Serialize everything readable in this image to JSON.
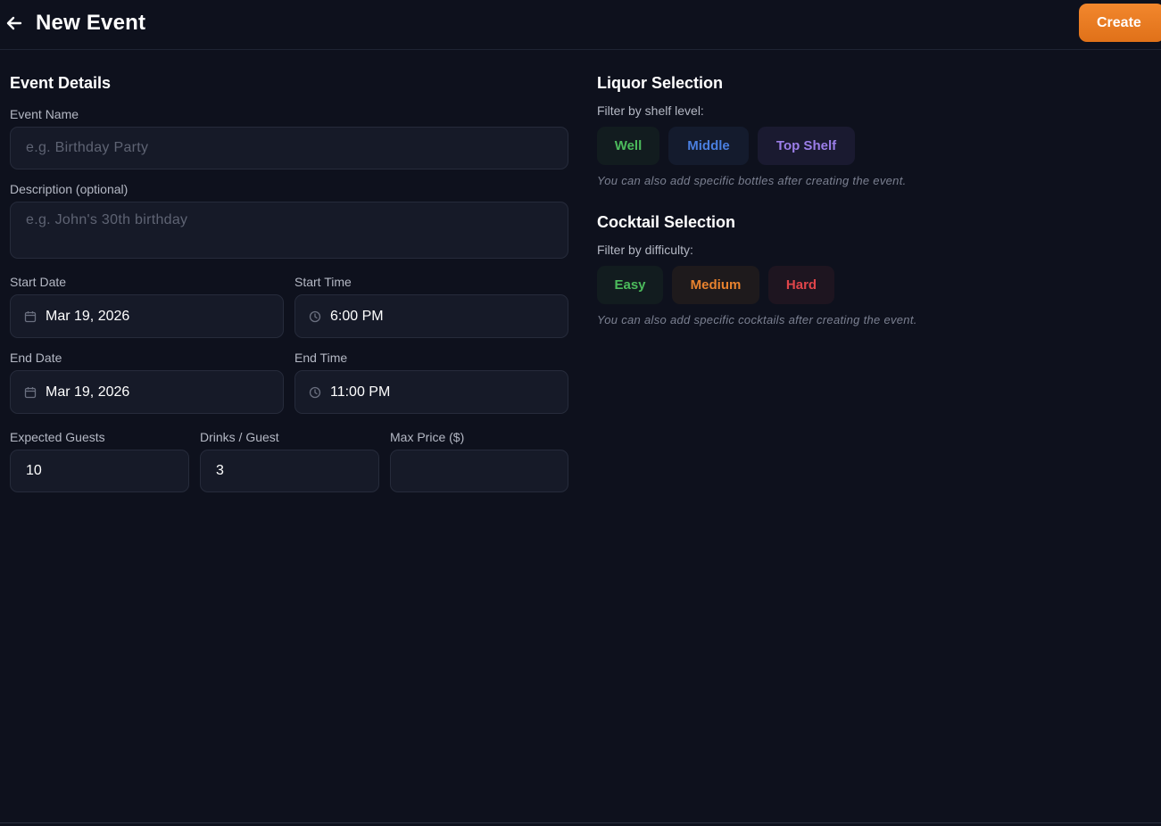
{
  "header": {
    "title": "New Event",
    "create_label": "Create"
  },
  "event_details": {
    "title": "Event Details",
    "name_label": "Event Name",
    "name_placeholder": "e.g. Birthday Party",
    "description_label": "Description (optional)",
    "description_placeholder": "e.g. John's 30th birthday",
    "start_date_label": "Start Date",
    "start_date_value": "Mar 19, 2026",
    "start_time_label": "Start Time",
    "start_time_value": "6:00 PM",
    "end_date_label": "End Date",
    "end_date_value": "Mar 19, 2026",
    "end_time_label": "End Time",
    "end_time_value": "11:00 PM",
    "guests_label": "Expected Guests",
    "guests_value": "10",
    "drinks_label": "Drinks / Guest",
    "drinks_value": "3",
    "max_price_label": "Max Price ($)",
    "max_price_value": ""
  },
  "liquor": {
    "title": "Liquor Selection",
    "filter_label": "Filter by shelf level:",
    "chips": [
      {
        "label": "Well",
        "color": "#4cbb5c",
        "bg": "#121c1f"
      },
      {
        "label": "Middle",
        "color": "#4a7fe0",
        "bg": "#141b2d"
      },
      {
        "label": "Top Shelf",
        "color": "#9b7ee8",
        "bg": "#1a1a30"
      }
    ],
    "hint": "You can also add specific bottles after creating the event."
  },
  "cocktail": {
    "title": "Cocktail Selection",
    "filter_label": "Filter by difficulty:",
    "chips": [
      {
        "label": "Easy",
        "color": "#4cbb5c",
        "bg": "#121c1f"
      },
      {
        "label": "Medium",
        "color": "#e8822e",
        "bg": "#1e1a1c"
      },
      {
        "label": "Hard",
        "color": "#e0454a",
        "bg": "#1e1520"
      }
    ],
    "hint": "You can also add specific cocktails after creating the event."
  },
  "icons": {
    "back": "arrow-left-icon",
    "calendar": "calendar-icon",
    "clock": "clock-icon"
  }
}
